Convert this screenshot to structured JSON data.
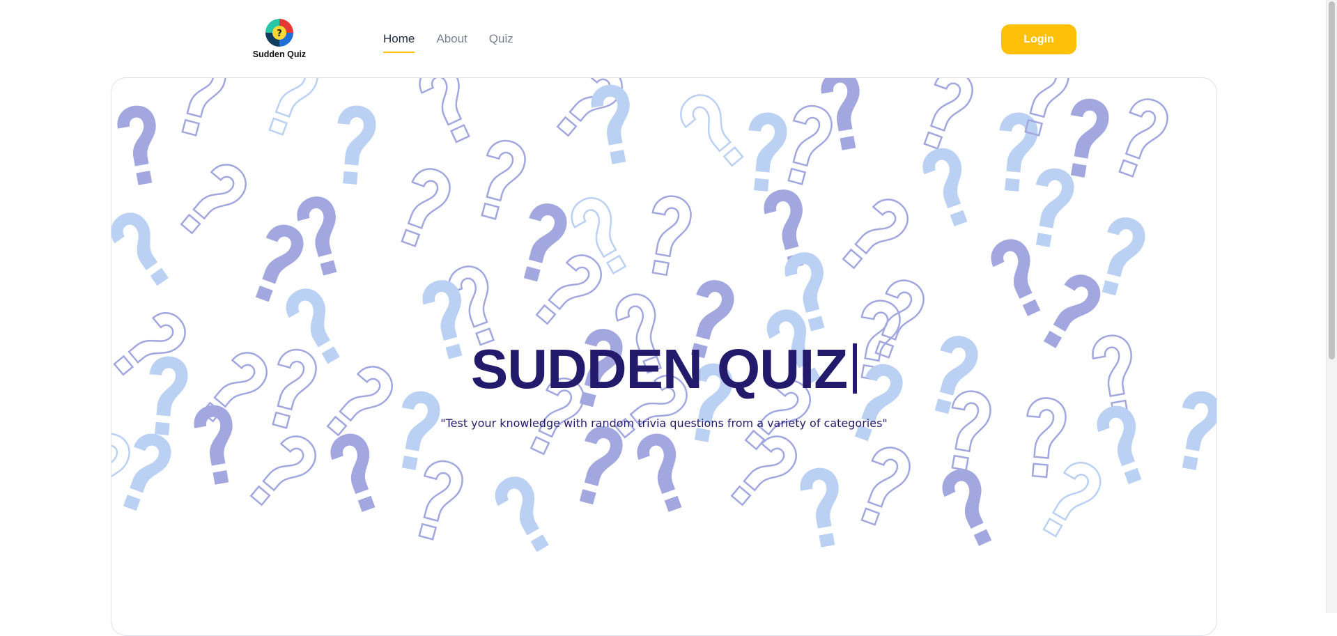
{
  "logo": {
    "text": "Sudden Quiz",
    "icon": "question-mark-icon",
    "colors": [
      "#e53935",
      "#43a047",
      "#1e88e5",
      "#fdd835"
    ]
  },
  "nav": {
    "items": [
      {
        "label": "Home",
        "active": true
      },
      {
        "label": "About",
        "active": false
      },
      {
        "label": "Quiz",
        "active": false
      }
    ]
  },
  "login": {
    "label": "Login"
  },
  "hero": {
    "title": "SUDDEN QUIZ",
    "subtitle": "\"Test your knowledge with random trivia questions from a variety of categories\"",
    "background_icon": "question-mark-pattern"
  },
  "colors": {
    "accent": "#ffc107",
    "title": "#241a6b",
    "pattern_dark": "#a2a7e0",
    "pattern_light": "#bbd1f3"
  }
}
